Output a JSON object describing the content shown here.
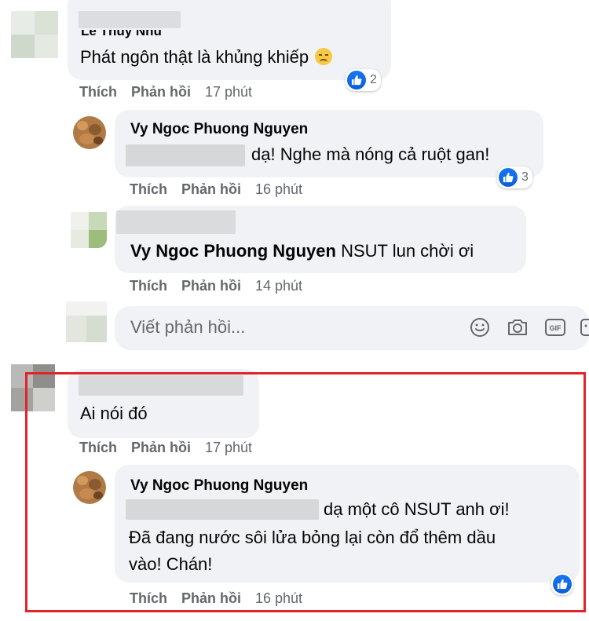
{
  "comments": [
    {
      "name": "Le Thuy Nhu",
      "text": "Phát ngôn thật là khủng khiếp",
      "emoji": "😞",
      "like": "Thích",
      "reply": "Phản hồi",
      "time": "17 phút",
      "reactions": "2",
      "replies": [
        {
          "name": "Vy Ngoc Phuong Nguyen",
          "text": "dạ! Nghe mà nóng cả ruột gan!",
          "like": "Thích",
          "reply": "Phản hồi",
          "time": "16 phút",
          "reactions": "3"
        },
        {
          "mention": "Vy Ngoc Phuong Nguyen",
          "text": "NSUT lun chời ơi",
          "like": "Thích",
          "reply": "Phản hồi",
          "time": "14 phút"
        }
      ],
      "reply_input": {
        "placeholder": "Viết phản hồi...",
        "icons": [
          "smiley-icon",
          "camera-icon",
          "gif-icon",
          "sticker-icon"
        ]
      }
    },
    {
      "text": "Ai nói đó",
      "like": "Thích",
      "reply": "Phản hồi",
      "time": "17 phút",
      "replies": [
        {
          "name": "Vy Ngoc Phuong Nguyen",
          "lines": [
            "dạ một cô NSUT anh ơi!",
            "Đã đang nước sôi lửa bỏng lại còn đổ thêm dầu",
            "vào! Chán!"
          ],
          "like": "Thích",
          "reply": "Phản hồi",
          "time": "16 phút"
        }
      ]
    }
  ],
  "colors": {
    "bubble": "#f0f2f5",
    "meta": "#65676b",
    "like_blue": "#1877f2",
    "highlight": "#e0242b"
  }
}
